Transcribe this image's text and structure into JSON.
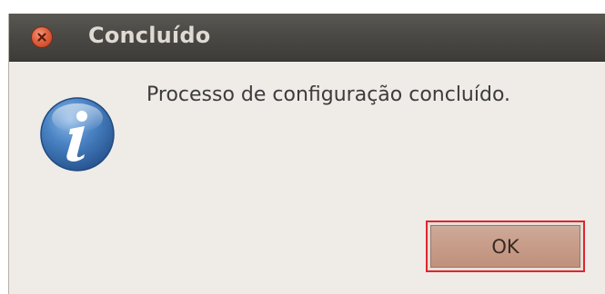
{
  "window": {
    "title": "Concluído"
  },
  "dialog": {
    "message": "Processo de configuração concluído.",
    "icon": "info-icon"
  },
  "buttons": {
    "ok_label": "OK"
  },
  "colors": {
    "titlebar": "#4b4945",
    "title_text": "#dfdbd2",
    "dialog_background": "#efebe7",
    "close_button": "#e0603f",
    "info_icon": "#3f78b8",
    "ok_button_fill": "#c79c88",
    "focus_highlight": "#e0252f"
  }
}
